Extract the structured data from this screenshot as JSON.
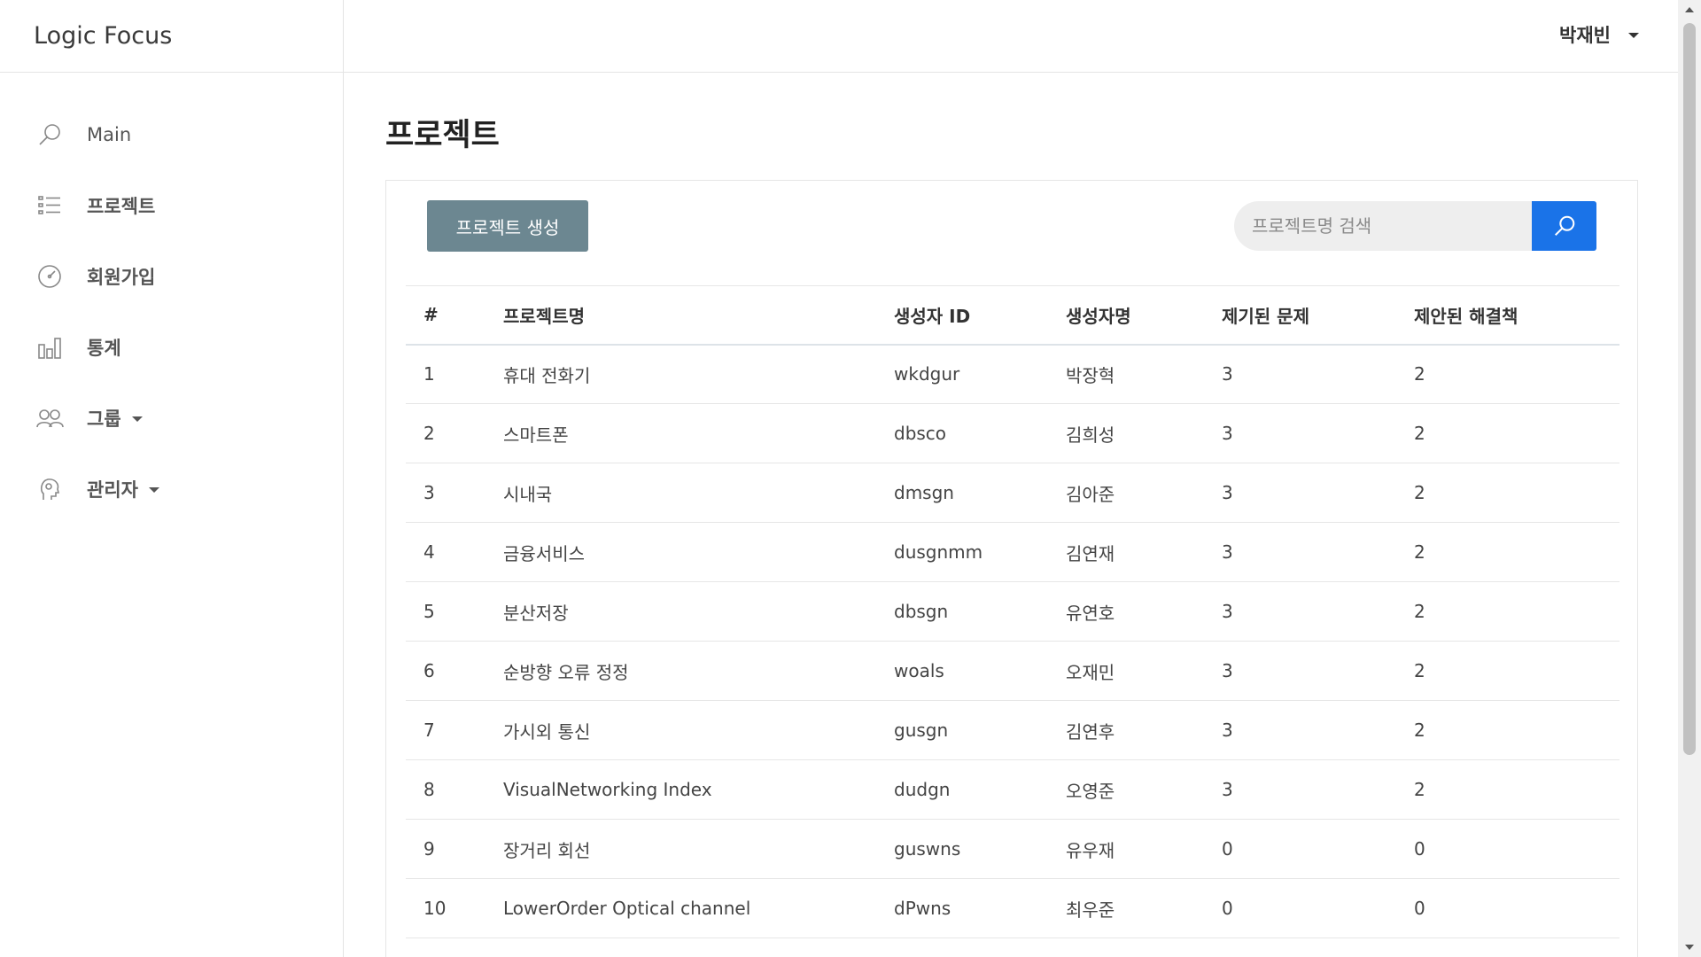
{
  "brand": "Logic Focus",
  "user": {
    "name": "박재빈"
  },
  "sidebar": {
    "items": [
      {
        "label": "Main",
        "icon": "search-icon"
      },
      {
        "label": "프로젝트",
        "icon": "list-icon"
      },
      {
        "label": "회원가입",
        "icon": "gauge-icon"
      },
      {
        "label": "통계",
        "icon": "bar-chart-icon"
      },
      {
        "label": "그룹",
        "icon": "users-icon"
      },
      {
        "label": "관리자",
        "icon": "head-icon"
      }
    ]
  },
  "page": {
    "title": "프로젝트",
    "create_button": "프로젝트 생성",
    "search_placeholder": "프로젝트명 검색"
  },
  "table": {
    "headers": [
      "#",
      "프로젝트명",
      "생성자 ID",
      "생성자명",
      "제기된 문제",
      "제안된 해결책"
    ],
    "rows": [
      [
        "1",
        "휴대 전화기",
        "wkdgur",
        "박장혁",
        "3",
        "2"
      ],
      [
        "2",
        "스마트폰",
        "dbsco",
        "김희성",
        "3",
        "2"
      ],
      [
        "3",
        "시내국",
        "dmsgn",
        "김아준",
        "3",
        "2"
      ],
      [
        "4",
        "금융서비스",
        "dusgnmm",
        "김연재",
        "3",
        "2"
      ],
      [
        "5",
        "분산저장",
        "dbsgn",
        "유연호",
        "3",
        "2"
      ],
      [
        "6",
        "순방향 오류 정정",
        "woals",
        "오재민",
        "3",
        "2"
      ],
      [
        "7",
        "가시외 통신",
        "gusgn",
        "김연후",
        "3",
        "2"
      ],
      [
        "8",
        "VisualNetworking Index",
        "dudgn",
        "오영준",
        "3",
        "2"
      ],
      [
        "9",
        "장거리 회선",
        "guswns",
        "유우재",
        "0",
        "0"
      ],
      [
        "10",
        "LowerOrder Optical channel",
        "dPwns",
        "최우준",
        "0",
        "0"
      ]
    ]
  },
  "colors": {
    "create_button_bg": "#6c8791",
    "search_button_bg": "#1a73e8"
  }
}
